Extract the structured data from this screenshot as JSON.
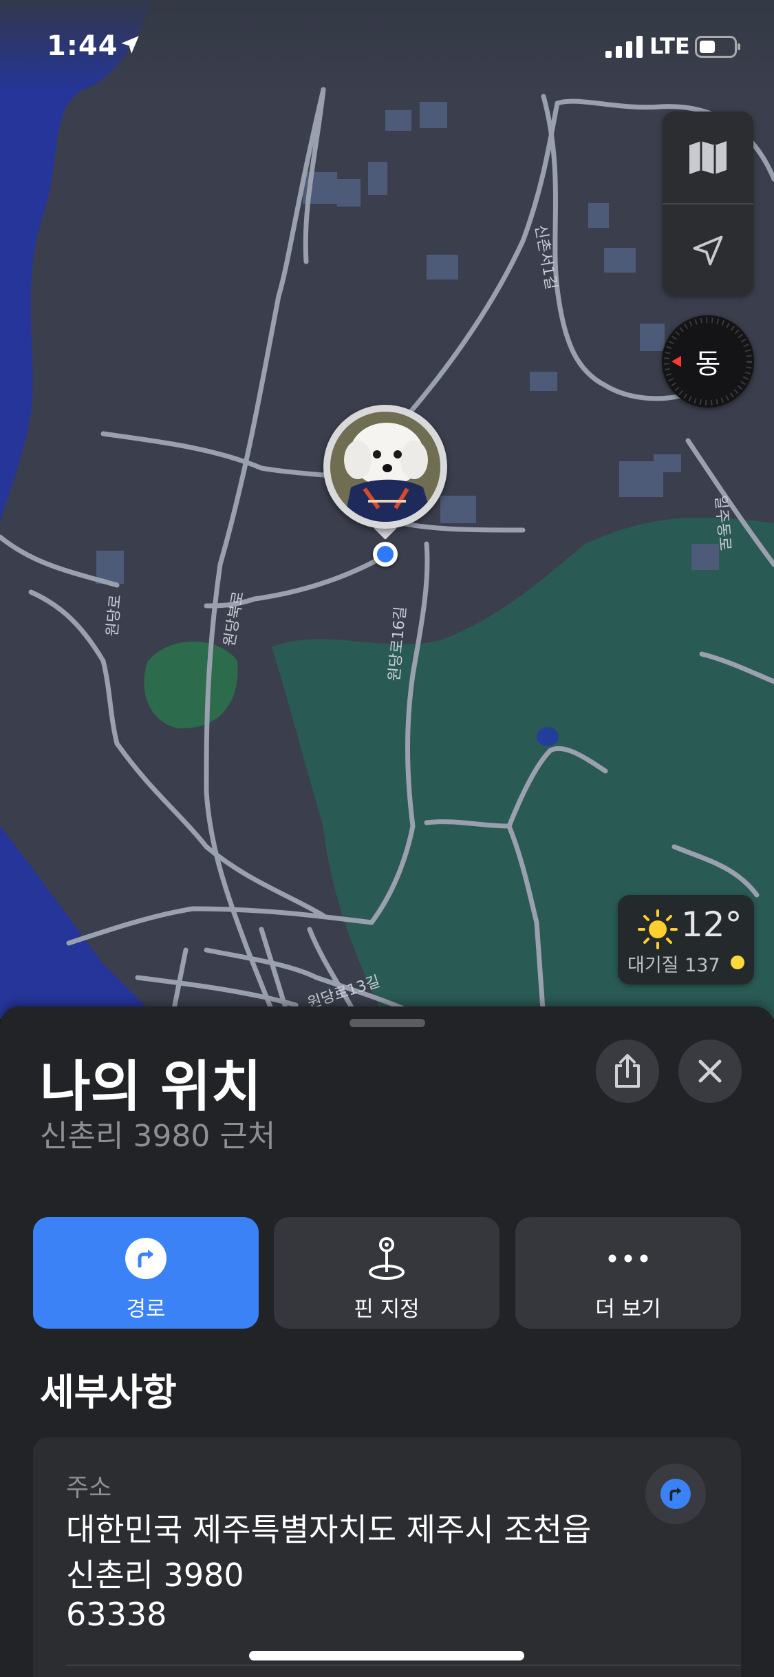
{
  "status_bar": {
    "time": "1:44",
    "network": "LTE",
    "icons": [
      "location-arrow-icon",
      "signal-icon",
      "battery-icon"
    ]
  },
  "map": {
    "road_labels": [
      "신촌서1길",
      "일주동로",
      "원당북로",
      "원당로16길",
      "원당로",
      "원당로13길"
    ],
    "compass_label": "동",
    "weather": {
      "temperature": "12°",
      "air_quality": "대기질 137",
      "icon": "sun-icon",
      "aqi_color": "#ffd93b"
    },
    "controls": [
      "map-mode-icon",
      "location-arrow-icon"
    ]
  },
  "sheet": {
    "title": "나의 위치",
    "subtitle": "신촌리 3980 근처",
    "actions": [
      {
        "label": "경로",
        "icon": "directions-icon"
      },
      {
        "label": "핀 지정",
        "icon": "pin-icon"
      },
      {
        "label": "더 보기",
        "icon": "ellipsis-icon"
      }
    ],
    "details_title": "세부사항",
    "address": {
      "label": "주소",
      "lines": [
        "대한민국 제주특별자치도 제주시 조천읍",
        "신촌리 3980",
        "63338"
      ]
    }
  },
  "colors": {
    "accent": "#3b82f6",
    "sheet_bg": "#222327",
    "card_bg": "#2c2d31",
    "map_land": "#3b3f4d",
    "map_sea": "#25359a",
    "map_park": "#2a5a54"
  }
}
